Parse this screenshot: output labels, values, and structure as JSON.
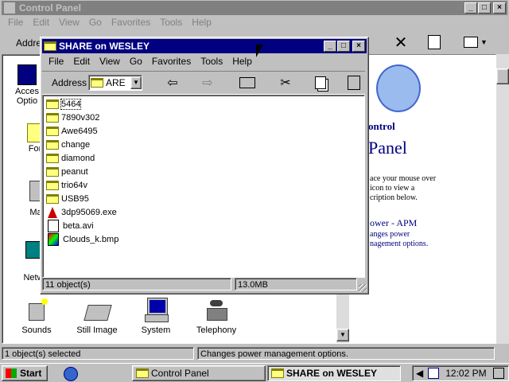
{
  "control_panel": {
    "title": "Control Panel",
    "menu": [
      "File",
      "Edit",
      "View",
      "Go",
      "Favorites",
      "Tools",
      "Help"
    ],
    "address_label": "Addre",
    "left_items": [
      "Acces",
      "Optio",
      "For",
      "Ma",
      "Netw"
    ],
    "right_pane": {
      "heading1": "ontrol",
      "heading2": "Panel",
      "desc": [
        "ace your mouse over",
        "icon to view a",
        "cription below."
      ],
      "link": "ower - APM",
      "link_desc": [
        "anges power",
        "nagement options."
      ]
    },
    "bottom_icons": [
      "Sounds",
      "Still Image",
      "System",
      "Telephony"
    ],
    "status": [
      "1 object(s) selected",
      "Changes power management options."
    ]
  },
  "share_window": {
    "title": "SHARE on WESLEY",
    "menu": [
      "File",
      "Edit",
      "View",
      "Go",
      "Favorites",
      "Tools",
      "Help"
    ],
    "address_label": "Address",
    "address_value": "ARE",
    "items": [
      {
        "name": "5464",
        "type": "folder"
      },
      {
        "name": "7890v302",
        "type": "folder"
      },
      {
        "name": "Awe6495",
        "type": "folder"
      },
      {
        "name": "change",
        "type": "folder"
      },
      {
        "name": "diamond",
        "type": "folder"
      },
      {
        "name": "peanut",
        "type": "folder"
      },
      {
        "name": "trio64v",
        "type": "folder"
      },
      {
        "name": "USB95",
        "type": "folder"
      },
      {
        "name": "3dp95069.exe",
        "type": "exe"
      },
      {
        "name": "beta.avi",
        "type": "avi"
      },
      {
        "name": "Clouds_k.bmp",
        "type": "bmp"
      }
    ],
    "status_count": "11 object(s)",
    "status_size": "13.0MB"
  },
  "taskbar": {
    "start": "Start",
    "tasks": [
      "Control Panel",
      "SHARE on WESLEY"
    ],
    "clock": "12:02 PM"
  }
}
